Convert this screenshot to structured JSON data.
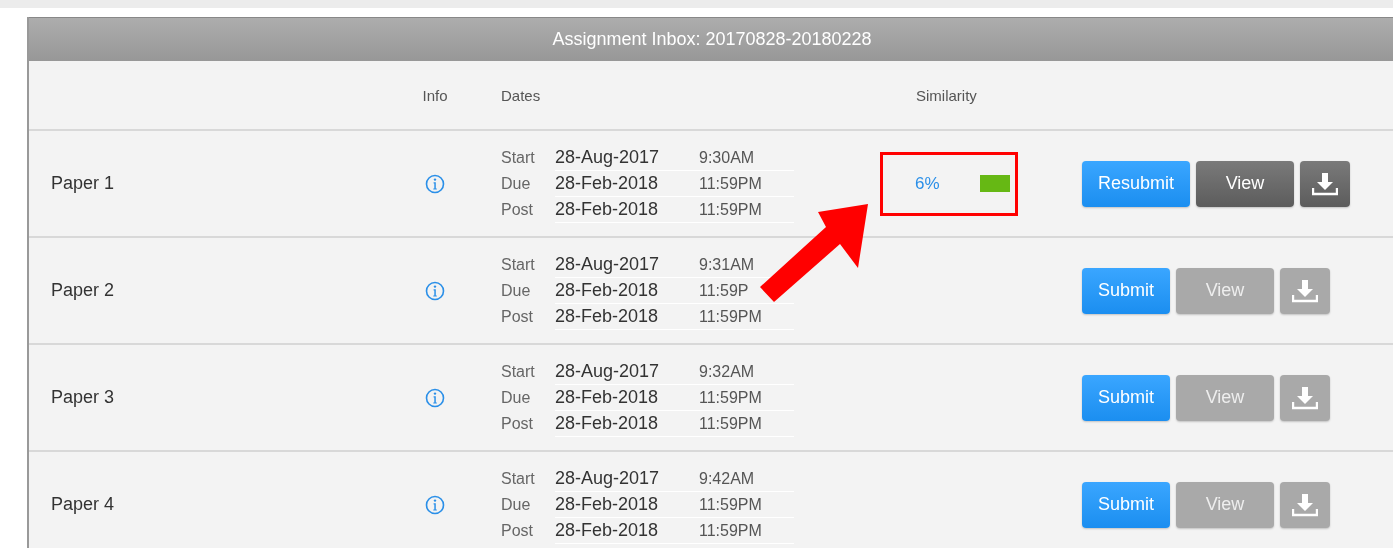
{
  "title": "Assignment Inbox: 20170828-20180228",
  "columns": [
    "Info",
    "Dates",
    "Similarity"
  ],
  "rows": [
    {
      "title": "Paper 1",
      "dates": [
        {
          "label": "Start",
          "date": "28-Aug-2017",
          "time": "9:30AM"
        },
        {
          "label": "Due",
          "date": "28-Feb-2018",
          "time": "11:59PM"
        },
        {
          "label": "Post",
          "date": "28-Feb-2018",
          "time": "11:59PM"
        }
      ],
      "similarity": {
        "score": "6%",
        "color": "#66b814",
        "highlighted": true
      },
      "submit": "Resubmit",
      "view": {
        "label": "View",
        "disabled": false
      },
      "download": {
        "disabled": false
      }
    },
    {
      "title": "Paper 2",
      "dates": [
        {
          "label": "Start",
          "date": "28-Aug-2017",
          "time": "9:31AM"
        },
        {
          "label": "Due",
          "date": "28-Feb-2018",
          "time": "11:59P"
        },
        {
          "label": "Post",
          "date": "28-Feb-2018",
          "time": "11:59PM"
        }
      ],
      "submit": "Submit",
      "view": {
        "label": "View",
        "disabled": true
      },
      "download": {
        "disabled": true
      }
    },
    {
      "title": "Paper 3",
      "dates": [
        {
          "label": "Start",
          "date": "28-Aug-2017",
          "time": "9:32AM"
        },
        {
          "label": "Due",
          "date": "28-Feb-2018",
          "time": "11:59PM"
        },
        {
          "label": "Post",
          "date": "28-Feb-2018",
          "time": "11:59PM"
        }
      ],
      "submit": "Submit",
      "view": {
        "label": "View",
        "disabled": true
      },
      "download": {
        "disabled": true
      }
    },
    {
      "title": "Paper 4",
      "dates": [
        {
          "label": "Start",
          "date": "28-Aug-2017",
          "time": "9:42AM"
        },
        {
          "label": "Due",
          "date": "28-Feb-2018",
          "time": "11:59PM"
        },
        {
          "label": "Post",
          "date": "28-Feb-2018",
          "time": "11:59PM"
        }
      ],
      "submit": "Submit",
      "view": {
        "label": "View",
        "disabled": true
      },
      "download": {
        "disabled": true
      }
    }
  ]
}
